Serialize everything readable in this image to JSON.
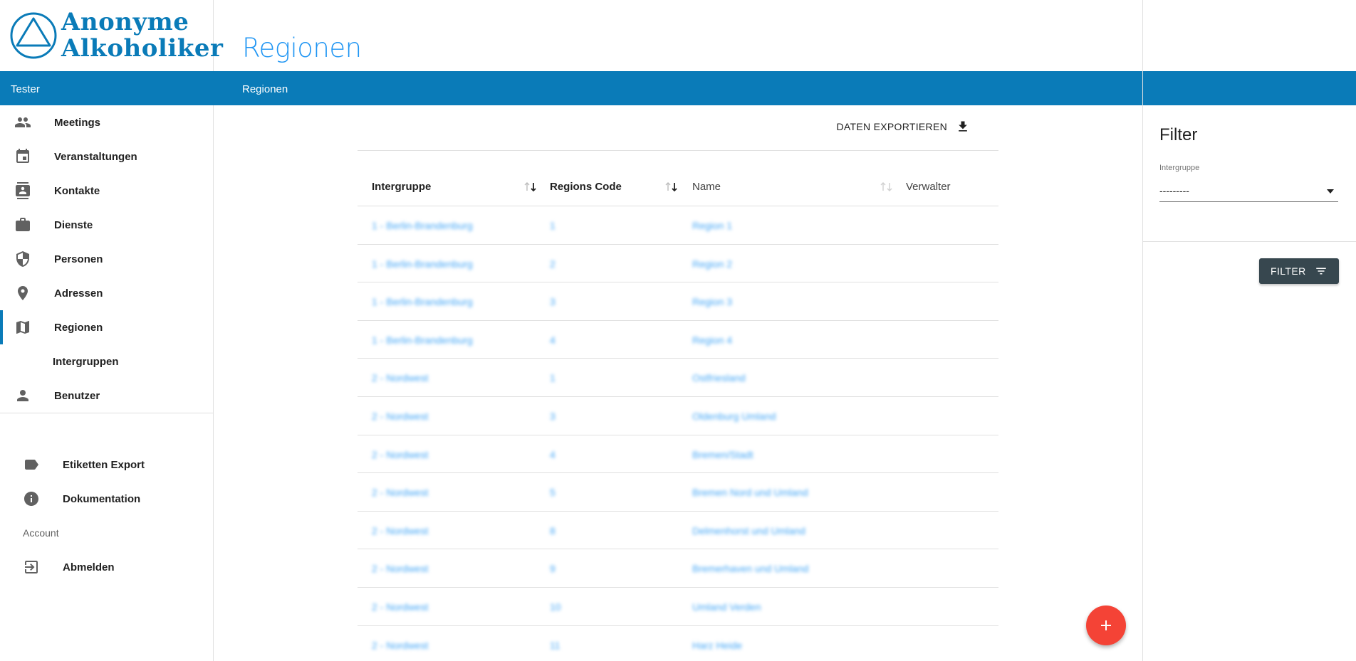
{
  "brand": {
    "line1": "Anonyme",
    "line2": "Alkoholiker",
    "color": "#0a7bb8"
  },
  "user": {
    "name": "Tester"
  },
  "nav": {
    "items": [
      {
        "label": "Meetings",
        "icon": "people-icon"
      },
      {
        "label": "Veranstaltungen",
        "icon": "calendar-icon"
      },
      {
        "label": "Kontakte",
        "icon": "contact-card-icon"
      },
      {
        "label": "Dienste",
        "icon": "briefcase-icon"
      },
      {
        "label": "Personen",
        "icon": "shield-icon"
      },
      {
        "label": "Adressen",
        "icon": "location-pin-icon"
      },
      {
        "label": "Regionen",
        "icon": "map-icon",
        "active": true
      },
      {
        "label": "Intergruppen",
        "icon": ""
      },
      {
        "label": "Benutzer",
        "icon": "person-icon"
      }
    ],
    "secondary": [
      {
        "label": "Etiketten Export",
        "icon": "label-tag-icon"
      },
      {
        "label": "Dokumentation",
        "icon": "info-icon"
      }
    ],
    "account_label": "Account",
    "logout": {
      "label": "Abmelden",
      "icon": "logout-icon"
    }
  },
  "page": {
    "title": "Regionen",
    "breadcrumb": "Regionen"
  },
  "toolbar": {
    "export_label": "DATEN EXPORTIEREN",
    "export_icon": "download-icon"
  },
  "table": {
    "columns": [
      "Intergruppe",
      "Regions Code",
      "Name",
      "Verwalter"
    ],
    "rows": [
      [
        "1 - Berlin-Brandenburg",
        "1",
        "Region 1",
        ""
      ],
      [
        "1 - Berlin-Brandenburg",
        "2",
        "Region 2",
        ""
      ],
      [
        "1 - Berlin-Brandenburg",
        "3",
        "Region 3",
        ""
      ],
      [
        "1 - Berlin-Brandenburg",
        "4",
        "Region 4",
        ""
      ],
      [
        "2 - Nordwest",
        "1",
        "Ostfriesland",
        ""
      ],
      [
        "2 - Nordwest",
        "3",
        "Oldenburg Umland",
        ""
      ],
      [
        "2 - Nordwest",
        "4",
        "Bremen/Stadt",
        ""
      ],
      [
        "2 - Nordwest",
        "5",
        "Bremen Nord und Umland",
        ""
      ],
      [
        "2 - Nordwest",
        "8",
        "Delmenhorst und Umland",
        ""
      ],
      [
        "2 - Nordwest",
        "9",
        "Bremerhaven und Umland",
        ""
      ],
      [
        "2 - Nordwest",
        "10",
        "Umland Verden",
        ""
      ],
      [
        "2 - Nordwest",
        "11",
        "Harz Heide",
        ""
      ]
    ],
    "link_color": "#42a5f5"
  },
  "filter": {
    "title": "Filter",
    "field_label": "Intergruppe",
    "field_value": "---------",
    "button_label": "FILTER",
    "button_icon": "filter-list-icon"
  },
  "fab": {
    "icon": "plus-icon",
    "color": "#f44336"
  }
}
